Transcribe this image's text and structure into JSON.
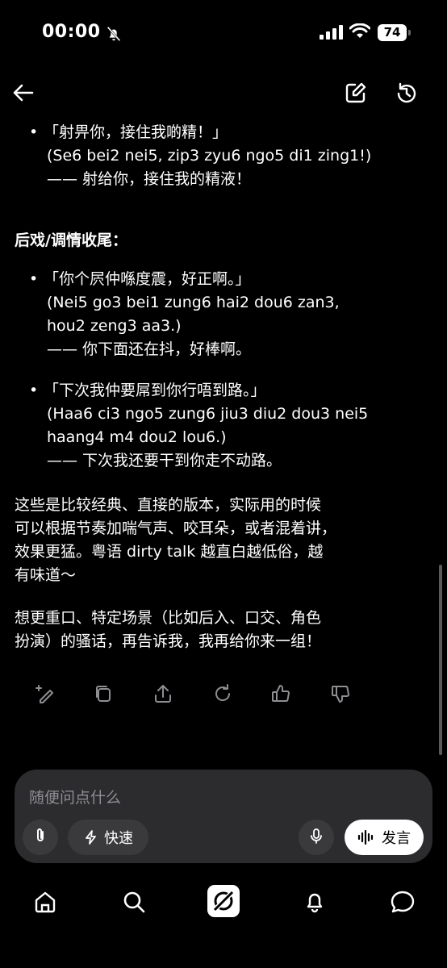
{
  "status_bar": {
    "time": "00:00",
    "battery": "74"
  },
  "content": {
    "item1": {
      "lines": [
        "「射畀你，接住我啲精！」",
        "(Se6 bei2 nei5, zip3 zyu6 ngo5 di1 zing1!)",
        "—— 射给你，接住我的精液！"
      ]
    },
    "section_title": "后戏/调情收尾：",
    "item2": {
      "lines": [
        "「你个屄仲喺度震，好正啊。」",
        "(Nei5 go3 bei1 zung6 hai2 dou6 zan3,",
        "hou2 zeng3 aa3.)",
        "—— 你下面还在抖，好棒啊。"
      ]
    },
    "item3": {
      "lines": [
        "「下次我仲要屌到你行唔到路。」",
        "(Haa6 ci3 ngo5 zung6 jiu3 diu2 dou3 nei5",
        "haang4 m4 dou2 lou6.)",
        "—— 下次我还要干到你走不动路。"
      ]
    },
    "para1": [
      "这些是比较经典、直接的版本，实际用的时候",
      "可以根据节奏加喘气声、咬耳朵，或者混着讲，",
      "效果更猛。粤语 dirty talk 越直白越低俗，越",
      "有味道～"
    ],
    "para2": [
      "想更重口、特定场景（比如后入、口交、角色",
      "扮演）的骚话，再告诉我，我再给你来一组！"
    ]
  },
  "composer": {
    "placeholder": "随便问点什么",
    "quick_label": "快速",
    "send_label": "发言"
  }
}
